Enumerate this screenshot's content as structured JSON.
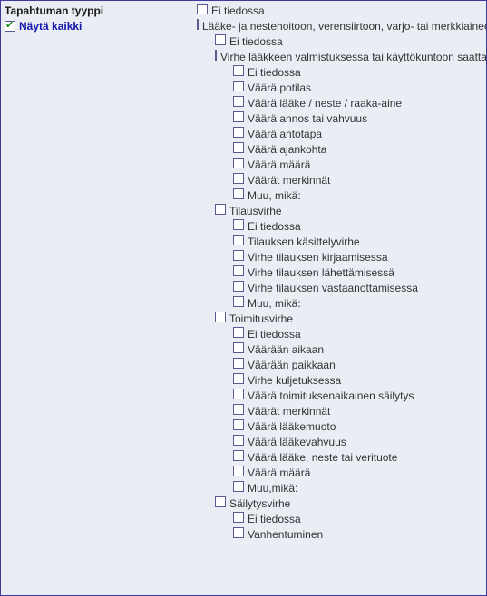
{
  "sidebar": {
    "title": "Tapahtuman tyyppi",
    "show_all_label": "Näytä kaikki",
    "show_all_checked": true
  },
  "tree": [
    {
      "indent": 0,
      "label": "Ei tiedossa"
    },
    {
      "indent": 0,
      "label": "Lääke- ja nestehoitoon, verensiirtoon, varjo- tai merkkiaineeseen liittyvä"
    },
    {
      "indent": 1,
      "label": "Ei tiedossa"
    },
    {
      "indent": 1,
      "label": "Virhe lääkkeen valmistuksessa tai käyttökuntoon saattamisessa"
    },
    {
      "indent": 2,
      "label": "Ei tiedossa"
    },
    {
      "indent": 2,
      "label": "Väärä potilas"
    },
    {
      "indent": 2,
      "label": "Väärä lääke / neste / raaka-aine"
    },
    {
      "indent": 2,
      "label": "Väärä annos tai vahvuus"
    },
    {
      "indent": 2,
      "label": "Väärä antotapa"
    },
    {
      "indent": 2,
      "label": "Väärä ajankohta"
    },
    {
      "indent": 2,
      "label": "Väärä määrä"
    },
    {
      "indent": 2,
      "label": "Väärät merkinnät"
    },
    {
      "indent": 2,
      "label": "Muu, mikä:"
    },
    {
      "indent": 1,
      "label": "Tilausvirhe"
    },
    {
      "indent": 2,
      "label": "Ei tiedossa"
    },
    {
      "indent": 2,
      "label": "Tilauksen käsittelyvirhe"
    },
    {
      "indent": 2,
      "label": "Virhe tilauksen kirjaamisessa"
    },
    {
      "indent": 2,
      "label": "Virhe tilauksen lähettämisessä"
    },
    {
      "indent": 2,
      "label": "Virhe tilauksen vastaanottamisessa"
    },
    {
      "indent": 2,
      "label": "Muu, mikä:"
    },
    {
      "indent": 1,
      "label": "Toimitusvirhe"
    },
    {
      "indent": 2,
      "label": "Ei tiedossa"
    },
    {
      "indent": 2,
      "label": "Väärään aikaan"
    },
    {
      "indent": 2,
      "label": "Väärään paikkaan"
    },
    {
      "indent": 2,
      "label": "Virhe kuljetuksessa"
    },
    {
      "indent": 2,
      "label": "Väärä toimituksenaikainen säilytys"
    },
    {
      "indent": 2,
      "label": "Väärät merkinnät"
    },
    {
      "indent": 2,
      "label": "Väärä lääkemuoto"
    },
    {
      "indent": 2,
      "label": "Väärä lääkevahvuus"
    },
    {
      "indent": 2,
      "label": "Väärä lääke, neste tai verituote"
    },
    {
      "indent": 2,
      "label": "Väärä määrä"
    },
    {
      "indent": 2,
      "label": "Muu,mikä:"
    },
    {
      "indent": 1,
      "label": "Säilytysvirhe"
    },
    {
      "indent": 2,
      "label": "Ei tiedossa"
    },
    {
      "indent": 2,
      "label": "Vanhentuminen"
    }
  ]
}
